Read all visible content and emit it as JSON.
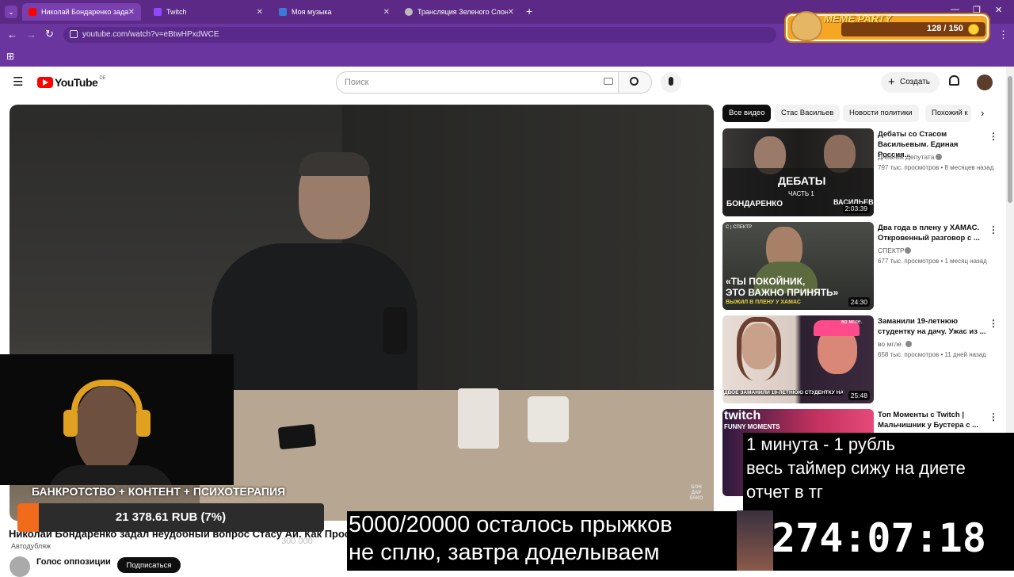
{
  "browser": {
    "tabs": [
      {
        "label": "Николай Бондаренко задал не",
        "favicon": "youtube-icon",
        "active": true
      },
      {
        "label": "Twitch",
        "favicon": "twitch-icon",
        "active": false
      },
      {
        "label": "Моя музыка",
        "favicon": "music-icon",
        "active": false
      },
      {
        "label": "Трансляция Зеленого Слоника",
        "favicon": "globe-icon",
        "active": false
      }
    ],
    "url": "youtube.com/watch?v=eBtwHPxdWCE"
  },
  "meme_party": {
    "title": "MEME PARTY",
    "count": "128 / 150"
  },
  "youtube": {
    "logo": "YouTube",
    "region": "DE",
    "search_placeholder": "Поиск",
    "create_label": "Создать"
  },
  "video": {
    "title": "Николай Бондаренко задал неудобный вопрос Стасу Ай. Как Просто",
    "autodub": "Автодубляж",
    "channel": "Голос оппозиции",
    "subscribe_label": "Подписаться",
    "views_partial": "300 000",
    "watermark": "БОН ДАР ЕНКО"
  },
  "chips": [
    "Все видео",
    "Стас Васильев",
    "Новости политики",
    "Похожий к"
  ],
  "recommendations": [
    {
      "title_line1": "Дебаты со Стасом",
      "title_line2": "Васильевым. Единая Россия...",
      "channel": "Дневник Депутата",
      "meta": "797 тыс. просмотров • 8 месяцев назад",
      "duration": "2:03:39",
      "thumb_text": "ДЕБАТЫ",
      "thumb_sub": "ЧАСТЬ 1",
      "thumb_left": "БОНДАРЕНКО",
      "thumb_right": "ВАСИЛЬЕВ"
    },
    {
      "title_line1": "Два года в плену у ХАМАС.",
      "title_line2": "Откровенный разговор с ...",
      "channel": "СПЕКТР",
      "meta": "677 тыс. просмотров • 1 месяц назад",
      "duration": "24:30",
      "thumb_text": "«ТЫ ПОКОЙНИК,",
      "thumb_sub": "ЭТО ВАЖНО ПРИНЯТЬ»",
      "thumb_left": "ВЫЖИЛ В ПЛЕНУ У ХАМАС",
      "thumb_right": "С | СПЕКТР"
    },
    {
      "title_line1": "Заманили 19-летнюю",
      "title_line2": "студентку на дачу. Ужас из ...",
      "channel": "во мгле.",
      "meta": "658 тыс. просмотров • 11 дней назад",
      "duration": "25:48",
      "thumb_text": "ДВОЕ ЗАМАНИЛИ 19-ЛЕТНЮЮ СТУДЕНТКУ НА",
      "thumb_sub": "во мгле.",
      "thumb_left": "",
      "thumb_right": ""
    },
    {
      "title_line1": "Топ Моменты с Twitch |",
      "title_line2": "Мальчишник у Бустера с ...",
      "channel": "",
      "meta": "",
      "duration": "",
      "thumb_text": "twitch",
      "thumb_sub": "FUNNY MOMENTS",
      "thumb_left": "",
      "thumb_right": ""
    }
  ],
  "overlays": {
    "banner": "БАНКРОТСТВО + КОНТЕНТ + ПСИХОТЕРАПИЯ",
    "goal_text": "21 378.61 RUB (7%)",
    "goal_fraction": 0.07,
    "rule_line1": "1 минута - 1 рубль",
    "rule_line2": "весь таймер сижу на диете",
    "rule_line3": "отчет в тг",
    "timer": "274:07:18",
    "jumps_line1": "5000/20000 осталось прыжков",
    "jumps_line2": "не сплю, завтра доделываем"
  },
  "colors": {
    "tabbar": "#5c2a86",
    "youtube_red": "#ff0000",
    "goal_fill": "#f26b1d"
  }
}
